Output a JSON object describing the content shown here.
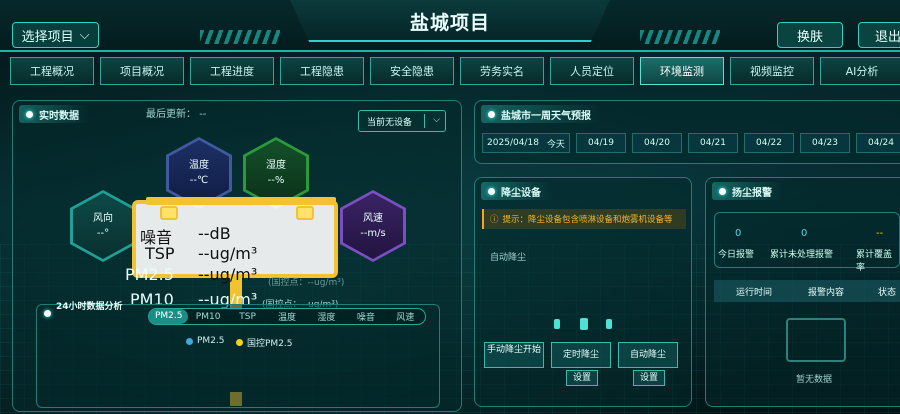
{
  "header": {
    "title": "盐城项目",
    "project_select": "选择项目",
    "skin_btn": "换肤",
    "logout_btn": "退出"
  },
  "nav": {
    "tabs": [
      "工程概况",
      "项目概况",
      "工程进度",
      "工程隐患",
      "安全隐患",
      "劳务实名",
      "人员定位",
      "环境监测",
      "视频监控",
      "AI分析"
    ],
    "active_index": 7
  },
  "realtime": {
    "title": "实时数据",
    "last_update_label": "最后更新：",
    "last_update_value": "--",
    "device_select": "当前无设备",
    "hex": {
      "temp_label": "温度",
      "temp_value": "--℃",
      "hum_label": "湿度",
      "hum_value": "--%",
      "wdir_label": "风向",
      "wdir_value": "--°",
      "wspd_label": "风速",
      "wspd_value": "--m/s"
    },
    "readings": {
      "noise_label": "噪音",
      "noise_value": "--dB",
      "tsp_label": "TSP",
      "tsp_value": "--ug/m³",
      "pm25_label": "PM2.5",
      "pm25_value": "--ug/m³",
      "pm10_label": "PM10",
      "pm10_value": "--ug/m³",
      "pm25_ctrl": "(国控点：--ug/m³)",
      "pm10_ctrl": "(国控点：--ug/m³)"
    }
  },
  "h24": {
    "title": "24小时数据分析",
    "tabs": [
      "PM2.5",
      "PM10",
      "TSP",
      "温度",
      "湿度",
      "噪音",
      "风速"
    ],
    "active_index": 0,
    "legend": [
      {
        "label": "PM2.5",
        "color": "#3fa9e0"
      },
      {
        "label": "国控PM2.5",
        "color": "#f2d21b"
      }
    ]
  },
  "weather": {
    "title": "盐城市一周天气预报",
    "dates": [
      "2025/04/18",
      "今天",
      "04/19",
      "04/20",
      "04/21",
      "04/22",
      "04/23",
      "04/24"
    ]
  },
  "dust": {
    "title": "降尘设备",
    "tip": "提示：降尘设备包含喷淋设备和炮雾机设备等",
    "auto_label": "自动降尘",
    "buttons": [
      "手动降尘开始",
      "定时降尘",
      "自动降尘"
    ],
    "set_label": "设置"
  },
  "alarm": {
    "title": "扬尘报警",
    "stats": [
      {
        "value": "0",
        "label": "今日报警"
      },
      {
        "value": "0",
        "label": "累计未处理报警"
      },
      {
        "value": "--",
        "label": "累计覆盖率"
      }
    ],
    "columns": [
      "运行时间",
      "报警内容",
      "状态"
    ],
    "empty": "暂无数据"
  }
}
